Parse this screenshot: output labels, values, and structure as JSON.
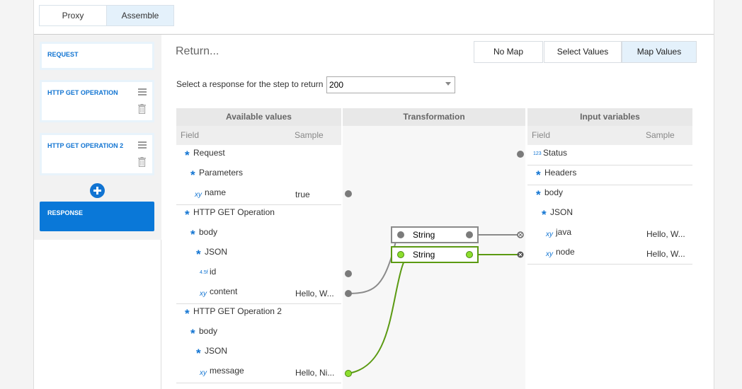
{
  "tabs": {
    "proxy": "Proxy",
    "assemble": "Assemble"
  },
  "sidebar": {
    "steps": [
      {
        "label": "REQUEST"
      },
      {
        "label": "HTTP GET OPERATION"
      },
      {
        "label": "HTTP GET OPERATION 2"
      },
      {
        "label": "RESPONSE"
      }
    ]
  },
  "main": {
    "title": "Return...",
    "map_options": {
      "no_map": "No Map",
      "select_values": "Select Values",
      "map_values": "Map Values"
    },
    "response_label": "Select a response for the step to return",
    "response_value": "200"
  },
  "grid": {
    "available": "Available values",
    "transformation": "Transformation",
    "input": "Input variables",
    "field": "Field",
    "sample": "Sample"
  },
  "available_rows": [
    {
      "icon": "obj",
      "label": "Request",
      "sample": ""
    },
    {
      "icon": "obj",
      "label": "Parameters",
      "sample": ""
    },
    {
      "icon": "str",
      "label": "name",
      "sample": "true"
    },
    {
      "icon": "obj",
      "label": "HTTP GET Operation",
      "sample": ""
    },
    {
      "icon": "obj",
      "label": "body",
      "sample": ""
    },
    {
      "icon": "obj",
      "label": "JSON",
      "sample": ""
    },
    {
      "icon": "num",
      "label": "id",
      "sample": ""
    },
    {
      "icon": "str",
      "label": "content",
      "sample": "Hello, W..."
    },
    {
      "icon": "obj",
      "label": "HTTP GET Operation 2",
      "sample": ""
    },
    {
      "icon": "obj",
      "label": "body",
      "sample": ""
    },
    {
      "icon": "obj",
      "label": "JSON",
      "sample": ""
    },
    {
      "icon": "str",
      "label": "message",
      "sample": "Hello, Ni..."
    }
  ],
  "input_rows": [
    {
      "icon": "int",
      "label": "Status",
      "sample": ""
    },
    {
      "icon": "obj",
      "label": "Headers",
      "sample": ""
    },
    {
      "icon": "obj",
      "label": "body",
      "sample": ""
    },
    {
      "icon": "obj",
      "label": "JSON",
      "sample": ""
    },
    {
      "icon": "str",
      "label": "java",
      "sample": "Hello, W..."
    },
    {
      "icon": "str",
      "label": "node",
      "sample": "Hello, W..."
    }
  ],
  "icon_glyphs": {
    "obj": "*",
    "str": "xy",
    "num": "4.5f",
    "int": "123"
  },
  "functions": [
    {
      "label": "String",
      "style": "gray"
    },
    {
      "label": "String",
      "style": "green"
    }
  ],
  "colors": {
    "accent": "#1174d2",
    "active_tab": "#e4f1fb",
    "wire_gray": "#8a8a8a",
    "wire_green": "#5b9a12"
  }
}
